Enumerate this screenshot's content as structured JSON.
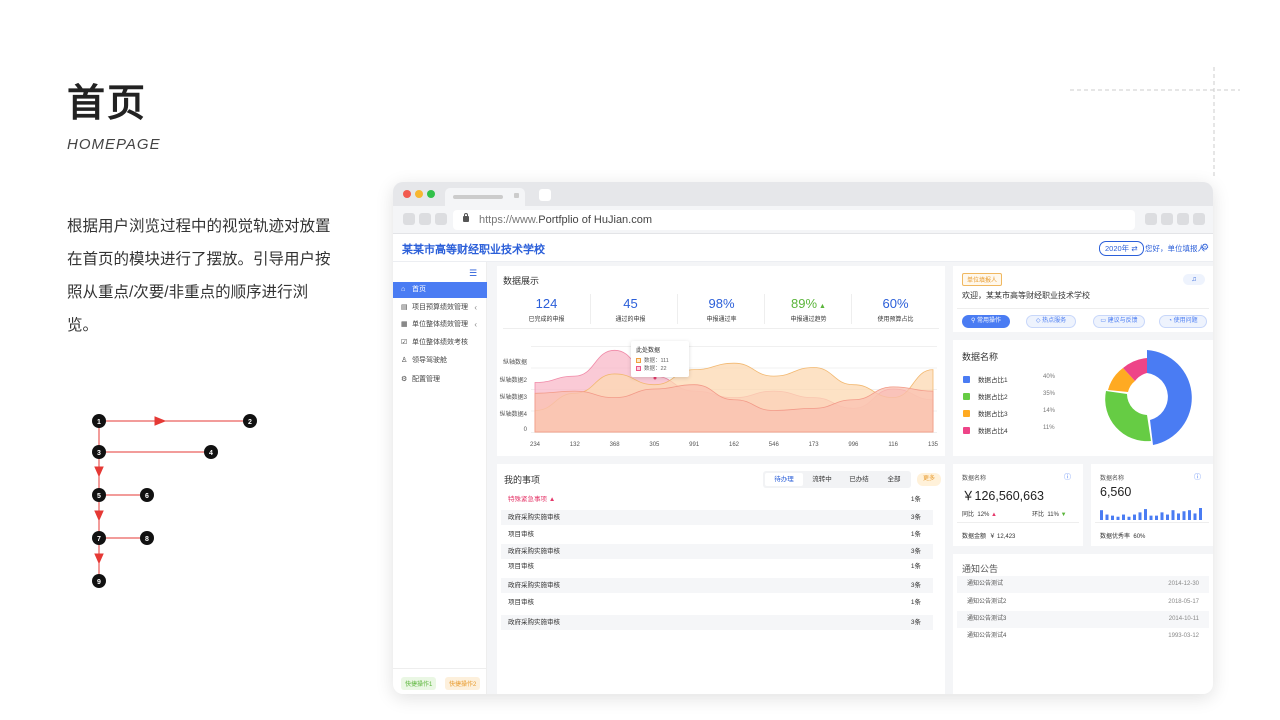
{
  "page": {
    "title": "首页",
    "subtitle": "HOMEPAGE",
    "description": "根据用户浏览过程中的视觉轨迹对放置在首页的模块进行了摆放。引导用户按照从重点/次要/非重点的顺序进行浏览。",
    "flow_nodes": [
      "1",
      "2",
      "3",
      "4",
      "5",
      "6",
      "7",
      "8",
      "9"
    ]
  },
  "browser": {
    "url_prefix": "https://www.",
    "url_domain": "Portfplio of HuJian.com"
  },
  "app": {
    "school_name": "某某市高等财经职业技术学校",
    "year_badge": "2020年 ⇄",
    "greeting": "您好，单位填报人",
    "sidebar": {
      "items": [
        {
          "icon": "⌂",
          "label": "首页",
          "active": true
        },
        {
          "icon": "▤",
          "label": "项目预算绩效管理",
          "arrow": "‹"
        },
        {
          "icon": "▦",
          "label": "单位整体绩效管理",
          "arrow": "‹"
        },
        {
          "icon": "☑",
          "label": "单位整体绩效考核"
        },
        {
          "icon": "♙",
          "label": "领导驾驶舱"
        },
        {
          "icon": "⚙",
          "label": "配置管理"
        }
      ],
      "footer_btn1": "快捷操作1",
      "footer_btn2": "快捷操作2"
    },
    "data_display": {
      "title": "数据展示",
      "stats": [
        {
          "value": "124",
          "label": "已完成的申报"
        },
        {
          "value": "45",
          "label": "通过的申报"
        },
        {
          "value": "98%",
          "label": "申报通过率"
        },
        {
          "value": "89%",
          "label": "申报通过趋势",
          "trend": "up"
        },
        {
          "value": "60%",
          "label": "使用预算占比"
        }
      ]
    },
    "chart_data": {
      "type": "area",
      "y_tick_labels": [
        "纵轴数据",
        "纵轴数据2",
        "纵轴数据3",
        "纵轴数据4",
        "0"
      ],
      "categories": [
        "234",
        "132",
        "368",
        "305",
        "991",
        "162",
        "546",
        "173",
        "996",
        "116",
        "135"
      ],
      "series": [
        {
          "color": "#f8b8c8",
          "values": [
            2.3,
            2.6,
            3.8,
            2.6,
            1.9,
            1.6,
            1.9,
            1.6,
            1.1,
            2.0,
            1.5
          ]
        },
        {
          "color": "#fcd8b2",
          "values": [
            1.0,
            1.8,
            2.7,
            2.2,
            2.9,
            3.2,
            2.6,
            3.0,
            2.2,
            1.6,
            2.9
          ]
        },
        {
          "color": "#f9c0b0",
          "values": [
            1.8,
            1.9,
            1.6,
            2.0,
            2.2,
            1.5,
            1.0,
            1.1,
            1.5,
            2.1,
            1.9
          ]
        }
      ],
      "tooltip": {
        "title": "此处数据",
        "row1": "数据：111",
        "row2": "数据：22"
      }
    },
    "welcome": {
      "badge": "单位填报人",
      "text": "欢迎，某某市高等财经职业技术学校",
      "buttons": [
        "常用操作",
        "热点服务",
        "建议与反馈",
        "使用问题"
      ]
    },
    "donut": {
      "title": "数据名称",
      "legend": [
        {
          "label": "数据占比1",
          "pct": "40%",
          "color": "#4a7cf3"
        },
        {
          "label": "数据占比2",
          "pct": "35%",
          "color": "#66cc44"
        },
        {
          "label": "数据占比3",
          "pct": "14%",
          "color": "#ffaa22"
        },
        {
          "label": "数据占比4",
          "pct": "11%",
          "color": "#ee4488"
        }
      ]
    },
    "todo": {
      "title": "我的事项",
      "tabs": [
        "待办理",
        "流转中",
        "已办结",
        "全部"
      ],
      "more": "更多",
      "rows": [
        {
          "name": "特殊紧急事项",
          "count": "1条",
          "urgent": true
        },
        {
          "name": "政府采购实施审核",
          "count": "3条"
        },
        {
          "name": "项目审核",
          "count": "1条"
        },
        {
          "name": "政府采购实施审核",
          "count": "3条"
        },
        {
          "name": "项目审核",
          "count": "1条"
        },
        {
          "name": "政府采购实施审核",
          "count": "3条"
        },
        {
          "name": "项目审核",
          "count": "1条"
        },
        {
          "name": "政府采购实施审核",
          "count": "3条"
        }
      ]
    },
    "metric1": {
      "name": "数据名称",
      "value": "￥126,560,663",
      "yoy_label": "同比",
      "yoy": "12%",
      "mom_label": "环比",
      "mom": "11%",
      "total_label": "数据金额",
      "total": "￥ 12,423"
    },
    "metric2": {
      "name": "数据名称",
      "value": "6,560",
      "rate_label": "数据优秀率",
      "rate": "60%",
      "bars": [
        9,
        5,
        4,
        3,
        5,
        3,
        5,
        7,
        10,
        4,
        4,
        7,
        5,
        9,
        6,
        8,
        9,
        6,
        11
      ]
    },
    "notices": {
      "title": "通知公告",
      "rows": [
        {
          "name": "通知公告测试",
          "date": "2014-12-30"
        },
        {
          "name": "通知公告测试2",
          "date": "2018-05-17"
        },
        {
          "name": "通知公告测试3",
          "date": "2014-10-11"
        },
        {
          "name": "通知公告测试4",
          "date": "1993-03-12"
        }
      ]
    }
  }
}
